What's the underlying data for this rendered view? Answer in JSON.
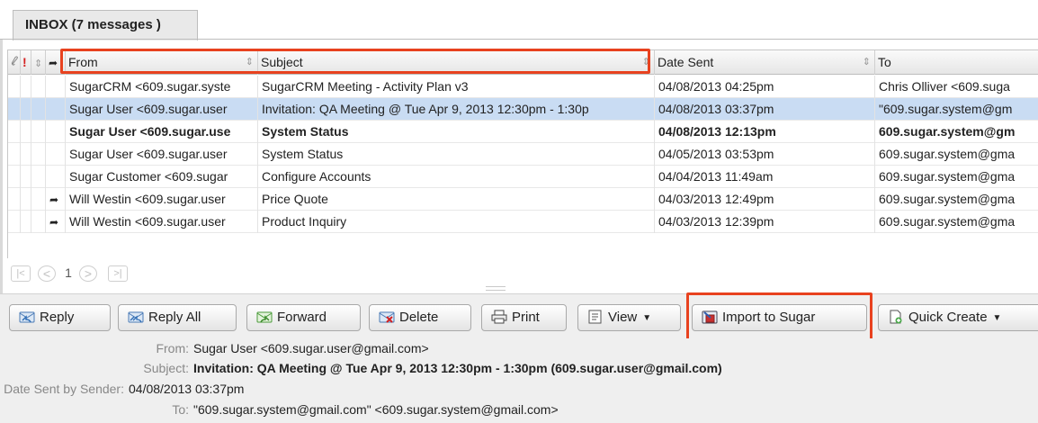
{
  "tab": {
    "label": "INBOX (7 messages )"
  },
  "columns": {
    "attachment_icon": "paperclip-icon",
    "importance_icon": "!",
    "from": "From",
    "subject": "Subject",
    "date_sent": "Date Sent",
    "to": "To"
  },
  "rows": [
    {
      "from": "SugarCRM <609.sugar.syste",
      "subject": "SugarCRM Meeting - Activity Plan v3",
      "date": "04/08/2013 04:25pm",
      "to": "Chris Olliver <609.suga",
      "bold": false,
      "replied": false,
      "selected": false
    },
    {
      "from": "Sugar User <609.sugar.user",
      "subject": "Invitation: QA Meeting @ Tue Apr 9, 2013 12:30pm - 1:30p",
      "date": "04/08/2013 03:37pm",
      "to": "\"609.sugar.system@gm",
      "bold": false,
      "replied": false,
      "selected": true
    },
    {
      "from": "Sugar User <609.sugar.use",
      "subject": "System Status",
      "date": "04/08/2013 12:13pm",
      "to": "609.sugar.system@gm",
      "bold": true,
      "replied": false,
      "selected": false
    },
    {
      "from": "Sugar User <609.sugar.user",
      "subject": "System Status",
      "date": "04/05/2013 03:53pm",
      "to": "609.sugar.system@gma",
      "bold": false,
      "replied": false,
      "selected": false
    },
    {
      "from": "Sugar Customer <609.sugar",
      "subject": "Configure Accounts",
      "date": "04/04/2013 11:49am",
      "to": "609.sugar.system@gma",
      "bold": false,
      "replied": false,
      "selected": false
    },
    {
      "from": "Will Westin <609.sugar.user",
      "subject": "Price Quote",
      "date": "04/03/2013 12:49pm",
      "to": "609.sugar.system@gma",
      "bold": false,
      "replied": true,
      "selected": false
    },
    {
      "from": "Will Westin <609.sugar.user",
      "subject": "Product Inquiry",
      "date": "04/03/2013 12:39pm",
      "to": "609.sugar.system@gma",
      "bold": false,
      "replied": true,
      "selected": false
    }
  ],
  "pager": {
    "first": "|<",
    "prev": "<",
    "page": "1",
    "next": ">",
    "last": ">|"
  },
  "toolbar": {
    "reply": "Reply",
    "reply_all": "Reply All",
    "forward": "Forward",
    "delete": "Delete",
    "print": "Print",
    "view": "View",
    "import": "Import to Sugar",
    "quick_create": "Quick Create"
  },
  "detail": {
    "from_label": "From:",
    "from_value": "Sugar User <609.sugar.user@gmail.com>",
    "subject_label": "Subject:",
    "subject_value": "Invitation: QA Meeting @ Tue Apr 9, 2013 12:30pm - 1:30pm (609.sugar.user@gmail.com)",
    "date_label": "Date Sent by Sender:",
    "date_value": "04/08/2013 03:37pm",
    "to_label": "To:",
    "to_value": "\"609.sugar.system@gmail.com\" <609.sugar.system@gmail.com>"
  },
  "colors": {
    "highlight": "#e8421f",
    "selected_row": "#c9dcf3",
    "toolbar_bg": "#efefef"
  }
}
